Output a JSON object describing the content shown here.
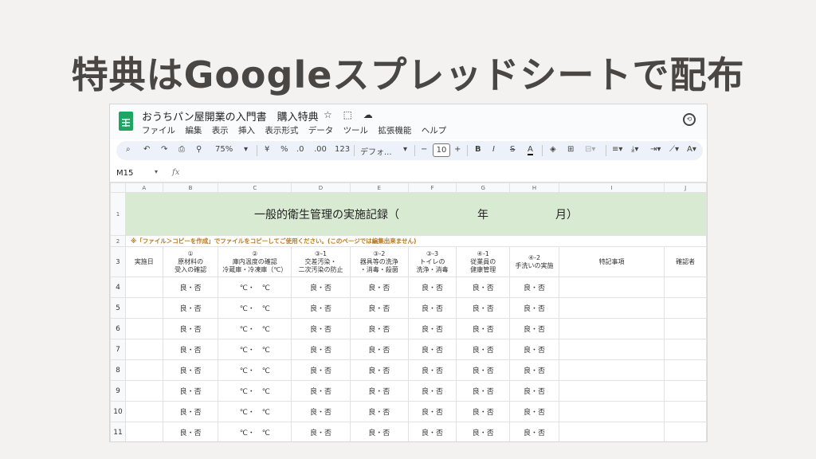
{
  "headline": "特典はGoogleスプレッドシートで配布",
  "app": {
    "doc_title": "おうちパン屋開業の入門書　購入特典",
    "title_icons": [
      "☆",
      "⬚",
      "☁"
    ],
    "menu": [
      "ファイル",
      "編集",
      "表示",
      "挿入",
      "表示形式",
      "データ",
      "ツール",
      "拡張機能",
      "ヘルプ"
    ],
    "toolbar": {
      "zoom": "75%",
      "currency": "¥",
      "percent": "%",
      "dec_decrease": ".0",
      "dec_increase": ".00",
      "number_format": "123",
      "font": "デフォ...",
      "font_size": "10",
      "minus": "−",
      "plus": "+",
      "bold": "B",
      "italic": "I",
      "strike": "S",
      "text_color": "A"
    },
    "name_box": "M15",
    "fx": "fx"
  },
  "sheet": {
    "columns": [
      "A",
      "B",
      "C",
      "D",
      "E",
      "F",
      "G",
      "H",
      "I",
      "J"
    ],
    "title": "一般的衛生管理の実施記録（　　　　　　　年　　　　　　月）",
    "note": "※「ファイル＞コピーを作成」でファイルをコピーしてご使用ください。(このページでは編集出来ません)",
    "headers": [
      "実施日",
      "①\n原材料の\n受入の確認",
      "②\n庫内温度の確認\n冷蔵庫・冷凍庫（℃）",
      "③-1\n交差汚染・\n二次汚染の防止",
      "③-2\n器具等の洗浄\n・消毒・殺菌",
      "③-3\nトイレの\n洗浄・消毒",
      "④-1\n従業員の\n健康管理",
      "④-2\n手洗いの実施",
      "特記事項",
      "確認者"
    ],
    "row_numbers": [
      "1",
      "2",
      "3",
      "4",
      "5",
      "6",
      "7",
      "8",
      "9",
      "10",
      "11"
    ],
    "ok_ng": "良・否",
    "temp": "℃・　℃",
    "data_rows": 8
  }
}
